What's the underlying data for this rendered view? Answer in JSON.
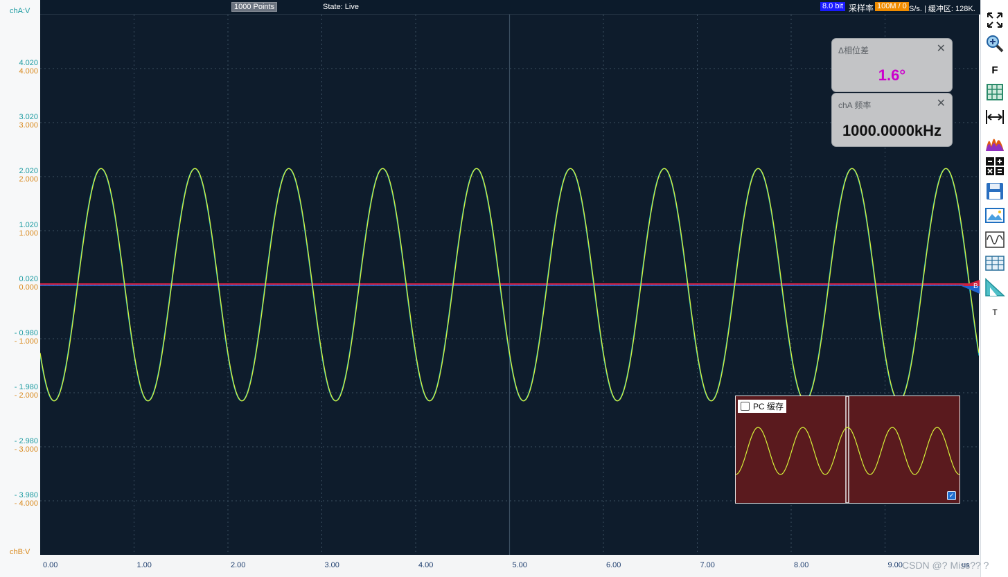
{
  "left_axis": {
    "cha_title": "chA:V",
    "chb_title": "chB:V",
    "cha_ticks": [
      "4.020",
      "3.020",
      "2.020",
      "1.020",
      "0.020",
      "- 0.980",
      "- 1.980",
      "- 2.980",
      "- 3.980"
    ],
    "chb_ticks": [
      "4.000",
      "3.000",
      "2.000",
      "1.000",
      "0.000",
      "- 1.000",
      "- 2.000",
      "- 3.000",
      "- 4.000"
    ]
  },
  "topbar": {
    "points_label": "1000 Points",
    "state": "State: Live",
    "bit_depth": "8.0 bit",
    "sample_rate_label": "采样率",
    "sample_rate_value": "100M / 0",
    "sample_rate_rest": "S/s. | 缓冲区: 128K."
  },
  "x_axis": {
    "ticks": [
      "0.00",
      "1.00",
      "2.00",
      "3.00",
      "4.00",
      "5.00",
      "6.00",
      "7.00",
      "8.00",
      "9.00"
    ],
    "unit": "us"
  },
  "measurements": {
    "phase": {
      "title": "Δ相位差",
      "value": "1.6°",
      "color": "#cc00cc"
    },
    "freq": {
      "title": "chA 频率",
      "value": "1000.0000kHz",
      "color": "#111111"
    }
  },
  "mini_view": {
    "label": "PC 缓存"
  },
  "marker": {
    "label": "B"
  },
  "toolbar": {
    "items": [
      "fullscreen-icon",
      "zoom-icon",
      "f-label",
      "grid-icon",
      "measure-icon",
      "histogram-icon",
      "math-icon",
      "save-icon",
      "screenshot-icon",
      "waveform-icon",
      "table-icon",
      "ruler-icon",
      "text-label"
    ],
    "f_label": "F",
    "t_label": "T"
  },
  "colors": {
    "plot_bg": "#0e1c2c",
    "grid": "#3c4f61",
    "cha_trace": "#d6f23a",
    "chb_trace": "#19b3c4",
    "mini_bg": "#5a1a1e"
  },
  "watermark": "CSDN @? Miss?? ?",
  "chart_data": {
    "type": "line",
    "x_unit": "us",
    "xlim": [
      0,
      10
    ],
    "ylim": [
      -5,
      5
    ],
    "frequency_khz": 1000,
    "amplitude_v": 2.15,
    "offset_v": 0,
    "series": [
      {
        "name": "chA"
      },
      {
        "name": "chB"
      }
    ]
  }
}
